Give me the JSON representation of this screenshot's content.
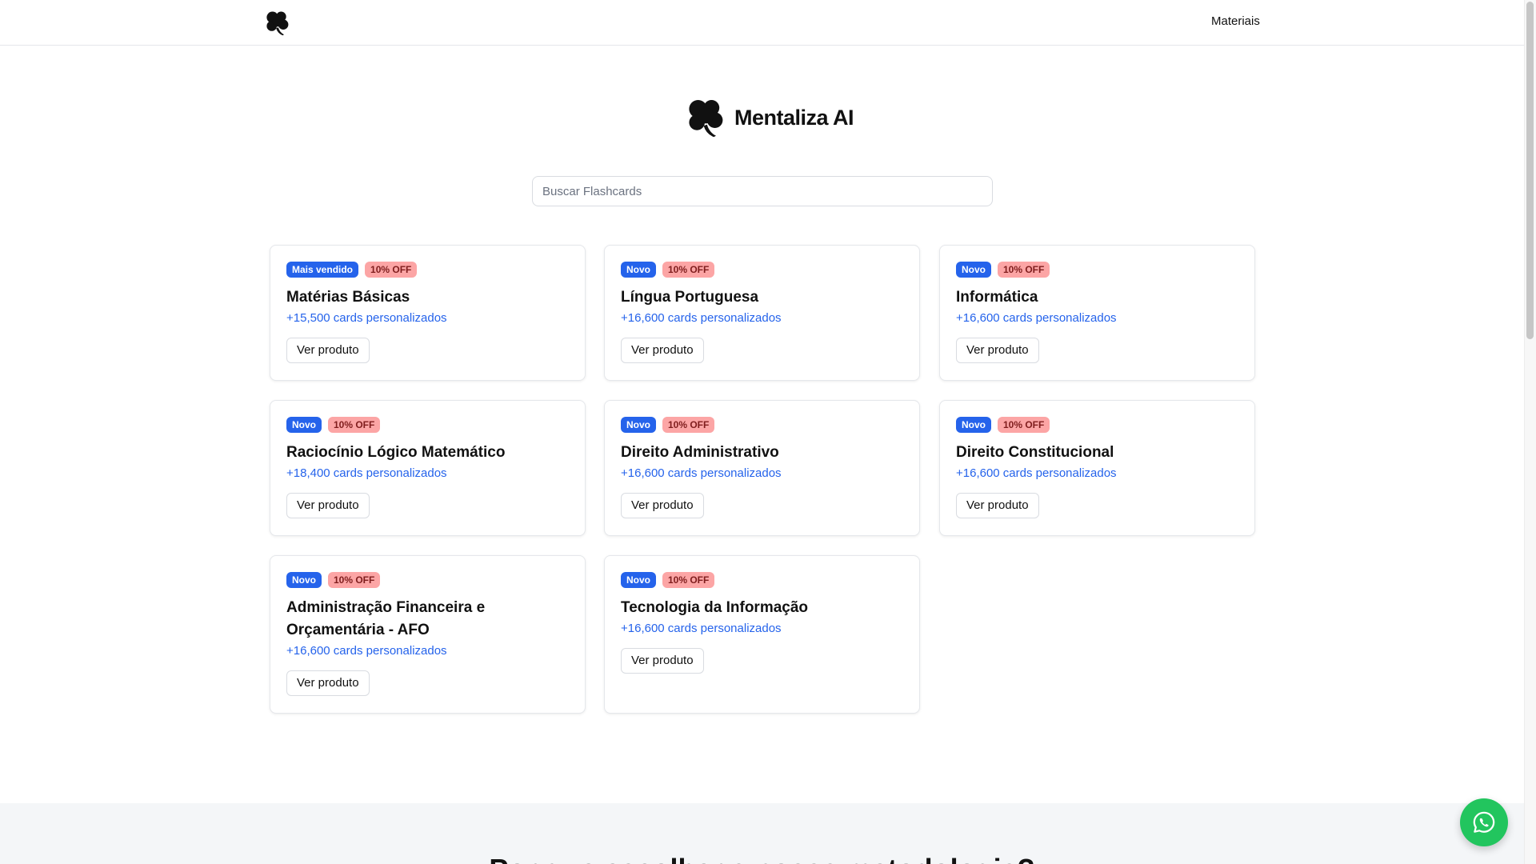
{
  "header": {
    "logo_icon": "clover-logo-icon",
    "nav_label": "Materiais"
  },
  "brand": {
    "name": "Mentaliza AI"
  },
  "search": {
    "placeholder": "Buscar Flashcards",
    "value": ""
  },
  "products": [
    {
      "badge": "Mais vendido",
      "discount": "10% OFF",
      "title": "Matérias Básicas",
      "subtitle": "+15,500 cards personalizados",
      "button": "Ver produto"
    },
    {
      "badge": "Novo",
      "discount": "10% OFF",
      "title": "Língua Portuguesa",
      "subtitle": "+16,600 cards personalizados",
      "button": "Ver produto"
    },
    {
      "badge": "Novo",
      "discount": "10% OFF",
      "title": "Informática",
      "subtitle": "+16,600 cards personalizados",
      "button": "Ver produto"
    },
    {
      "badge": "Novo",
      "discount": "10% OFF",
      "title": "Raciocínio Lógico Matemático",
      "subtitle": "+18,400 cards personalizados",
      "button": "Ver produto"
    },
    {
      "badge": "Novo",
      "discount": "10% OFF",
      "title": "Direito Administrativo",
      "subtitle": "+16,600 cards personalizados",
      "button": "Ver produto"
    },
    {
      "badge": "Novo",
      "discount": "10% OFF",
      "title": "Direito Constitucional",
      "subtitle": "+16,600 cards personalizados",
      "button": "Ver produto"
    },
    {
      "badge": "Novo",
      "discount": "10% OFF",
      "title": "Administração Financeira e Orçamentária - AFO",
      "subtitle": "+16,600 cards personalizados",
      "button": "Ver produto"
    },
    {
      "badge": "Novo",
      "discount": "10% OFF",
      "title": "Tecnologia da Informação",
      "subtitle": "+16,600 cards personalizados",
      "button": "Ver produto"
    }
  ],
  "footer": {
    "heading": "Por que escolher a nossa metodologia?"
  },
  "floating": {
    "icon": "whatsapp-icon"
  },
  "colors": {
    "accent": "#2563eb",
    "discount_bg": "#fca5a5",
    "whatsapp": "#22c55e"
  }
}
